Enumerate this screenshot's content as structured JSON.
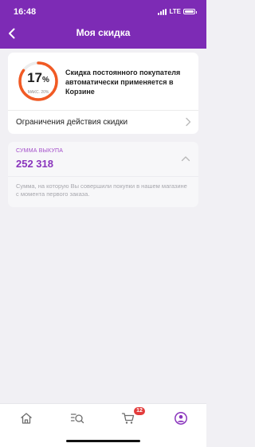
{
  "status_bar": {
    "time": "16:48",
    "network": "LTE"
  },
  "header": {
    "title": "Моя скидка",
    "back_icon": "chevron-left-icon"
  },
  "discount_card": {
    "percent": "17",
    "percent_sign": "%",
    "percent_value": 17,
    "max_percent": 20,
    "max_label": "МАКС. 20%",
    "description": "Скидка постоянного покупателя автоматически применяется в Корзине",
    "limits_label": "Ограничения действия скидки"
  },
  "purchase_card": {
    "label": "СУММА ВЫКУПА",
    "value": "252 318",
    "description": "Сумма, на которую Вы совершили покупки в нашем магазине с момента первого заказа."
  },
  "tabbar": {
    "items": [
      "home-icon",
      "catalog-search-icon",
      "cart-icon",
      "profile-icon"
    ],
    "cart_badge": "12",
    "active": "profile-icon"
  },
  "colors": {
    "brand": "#7d2bb5",
    "accent": "#8a35bd",
    "ring_fill": "#f15a24",
    "badge": "#e33c3c"
  }
}
